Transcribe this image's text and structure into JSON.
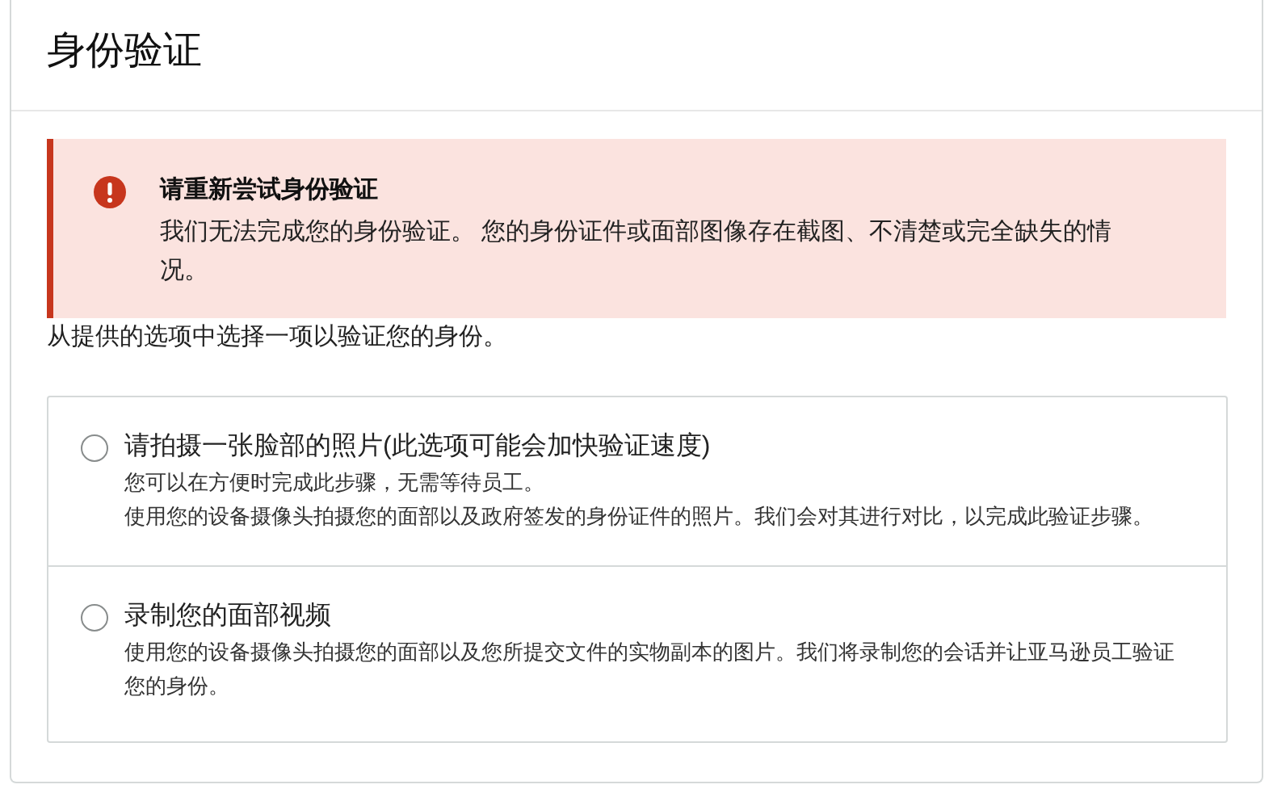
{
  "title": "身份验证",
  "alert": {
    "title": "请重新尝试身份验证",
    "message": "我们无法完成您的身份验证。 您的身份证件或面部图像存在截图、不清楚或完全缺失的情况。"
  },
  "instruction": "从提供的选项中选择一项以验证您的身份。",
  "options": [
    {
      "label": "请拍摄一张脸部的照片(此选项可能会加快验证速度)",
      "selected": false,
      "details": [
        "您可以在方便时完成此步骤，无需等待员工。",
        "使用您的设备摄像头拍摄您的面部以及政府签发的身份证件的照片。我们会对其进行对比，以完成此验证步骤。"
      ]
    },
    {
      "label": "录制您的面部视频",
      "selected": false,
      "details": [
        "使用您的设备摄像头拍摄您的面部以及您所提交文件的实物副本的图片。我们将录制您的会话并让亚马逊员工验证您的身份。"
      ]
    }
  ]
}
